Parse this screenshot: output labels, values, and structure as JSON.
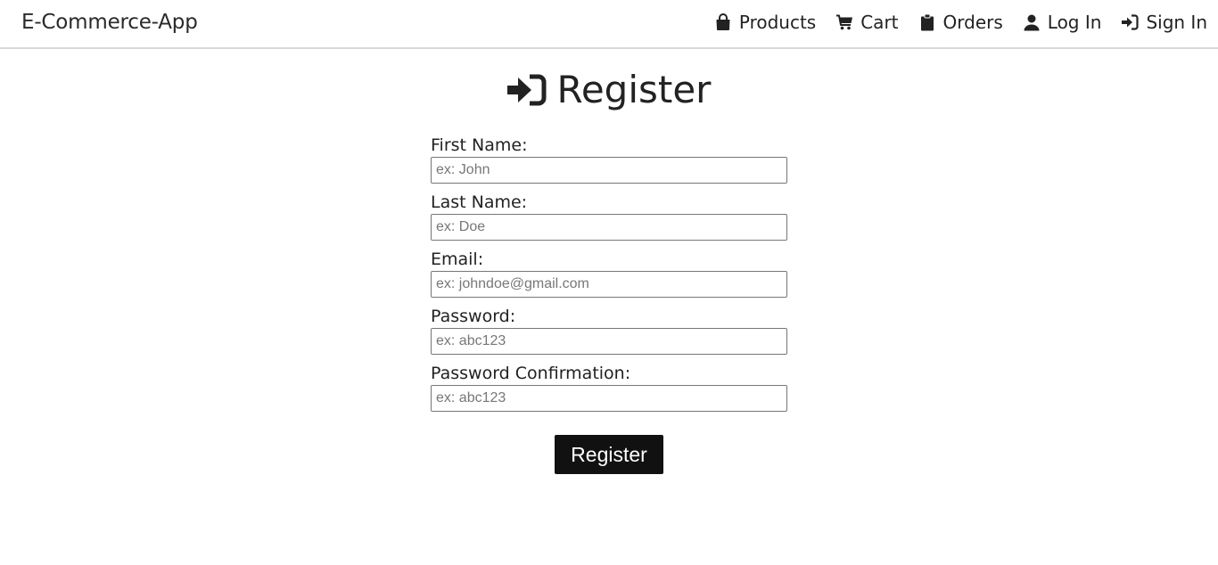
{
  "header": {
    "brand": "E-Commerce-App",
    "nav": [
      {
        "label": "Products",
        "icon": "shopping-bag-icon"
      },
      {
        "label": "Cart",
        "icon": "cart-icon"
      },
      {
        "label": "Orders",
        "icon": "clipboard-icon"
      },
      {
        "label": "Log In",
        "icon": "user-icon"
      },
      {
        "label": "Sign In",
        "icon": "sign-in-icon"
      }
    ]
  },
  "page": {
    "title": "Register",
    "title_icon": "sign-in-icon"
  },
  "form": {
    "fields": [
      {
        "label": "First Name:",
        "placeholder": "ex: John",
        "value": ""
      },
      {
        "label": "Last Name:",
        "placeholder": "ex: Doe",
        "value": ""
      },
      {
        "label": "Email:",
        "placeholder": "ex: johndoe@gmail.com",
        "value": ""
      },
      {
        "label": "Password:",
        "placeholder": "ex: abc123",
        "value": ""
      },
      {
        "label": "Password Confirmation:",
        "placeholder": "ex: abc123",
        "value": ""
      }
    ],
    "submit_label": "Register"
  },
  "colors": {
    "text": "#222222",
    "button_bg": "#111111",
    "button_text": "#ffffff",
    "border": "#777777",
    "divider": "#d9d9d9"
  }
}
